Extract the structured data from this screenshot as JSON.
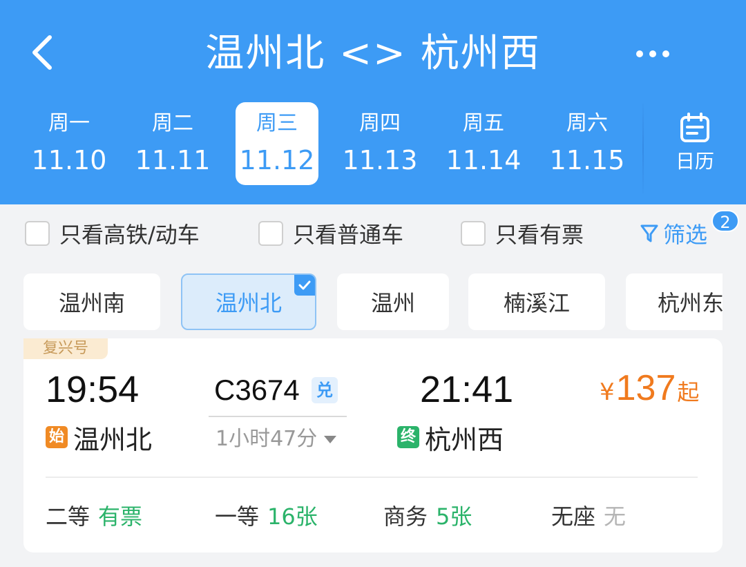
{
  "header": {
    "title": "温州北 <> 杭州西",
    "back_icon": "chevron-left-icon",
    "more_icon": "more-dots-icon",
    "background_color": "#3d9bf5"
  },
  "dates": [
    {
      "weekday": "周一",
      "date": "11.10",
      "active": false
    },
    {
      "weekday": "周二",
      "date": "11.11",
      "active": false
    },
    {
      "weekday": "周三",
      "date": "11.12",
      "active": true
    },
    {
      "weekday": "周四",
      "date": "11.13",
      "active": false
    },
    {
      "weekday": "周五",
      "date": "11.14",
      "active": false
    },
    {
      "weekday": "周六",
      "date": "11.15",
      "active": false
    }
  ],
  "calendar": {
    "label": "日历",
    "icon": "calendar-icon"
  },
  "filters": {
    "high_speed_only": {
      "label": "只看高铁/动车",
      "checked": false
    },
    "normal_only": {
      "label": "只看普通车",
      "checked": false
    },
    "available_only": {
      "label": "只看有票",
      "checked": false
    },
    "screen": {
      "label": "筛选",
      "icon": "funnel-icon",
      "badge": "2"
    }
  },
  "stations": [
    {
      "name": "温州南",
      "selected": false
    },
    {
      "name": "温州北",
      "selected": true
    },
    {
      "name": "温州",
      "selected": false
    },
    {
      "name": "楠溪江",
      "selected": false
    },
    {
      "name": "杭州东",
      "selected": false
    }
  ],
  "train": {
    "tag": "复兴号",
    "departure_time": "19:54",
    "departure_badge": "始",
    "departure_station": "温州北",
    "train_no": "C3674",
    "exchange_badge": "兑",
    "duration": "1小时47分",
    "arrival_time": "21:41",
    "arrival_badge": "终",
    "arrival_station": "杭州西",
    "price_symbol": "¥",
    "price": "137",
    "price_suffix": "起",
    "seats": [
      {
        "class": "二等",
        "status": "有票"
      },
      {
        "class": "一等",
        "status": "16张"
      },
      {
        "class": "商务",
        "status": "5张"
      },
      {
        "class": "无座",
        "status": "无"
      }
    ]
  },
  "colors": {
    "accent": "#3d9bf5",
    "price": "#f07a1e",
    "available": "#2bb36a",
    "start_badge": "#f08a24",
    "end_badge": "#2bb36a"
  }
}
